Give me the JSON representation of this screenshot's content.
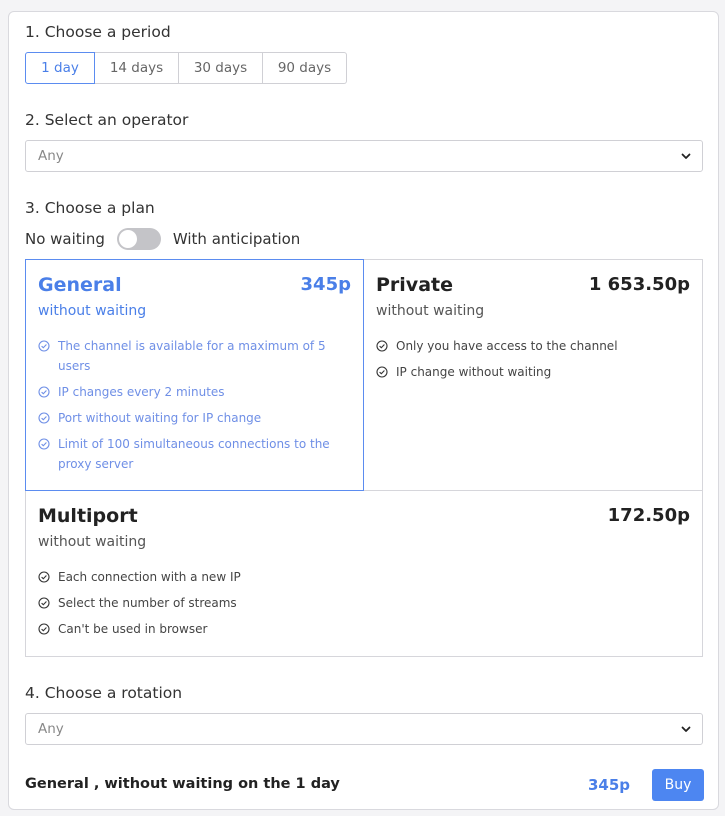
{
  "period": {
    "title": "1. Choose a period",
    "options": [
      "1 day",
      "14 days",
      "30 days",
      "90 days"
    ],
    "selected": "1 day"
  },
  "operator": {
    "title": "2. Select an operator",
    "value": "Any"
  },
  "plan": {
    "title": "3. Choose a plan",
    "toggle_left": "No waiting",
    "toggle_right": "With anticipation",
    "toggle_on": false,
    "plans": [
      {
        "name": "General",
        "price": "345p",
        "sub": "without waiting",
        "selected": true,
        "features": [
          "The channel is available for a maximum of 5 users",
          "IP changes every 2 minutes",
          "Port without waiting for IP change",
          "Limit of 100 simultaneous connections to the proxy server"
        ]
      },
      {
        "name": "Private",
        "price": "1 653.50p",
        "sub": "without waiting",
        "selected": false,
        "features": [
          "Only you have access to the channel",
          "IP change without waiting"
        ]
      },
      {
        "name": "Multiport",
        "price": "172.50p",
        "sub": "without waiting",
        "selected": false,
        "features": [
          "Each connection with a new IP",
          "Select the number of streams",
          "Can't be used in browser"
        ]
      }
    ]
  },
  "rotation": {
    "title": "4. Choose a rotation",
    "value": "Any"
  },
  "footer": {
    "summary": "General , without waiting on the 1 day",
    "total": "345p",
    "buy_label": "Buy"
  },
  "colors": {
    "accent": "#4a7fe8",
    "border": "#d6d6db"
  }
}
